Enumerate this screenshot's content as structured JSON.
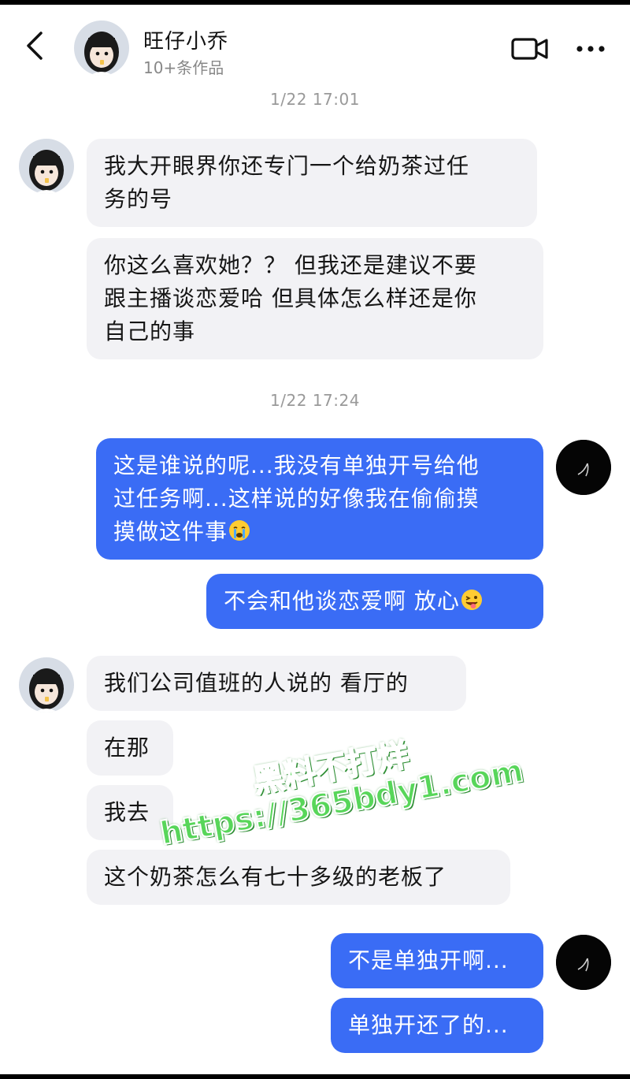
{
  "header": {
    "name": "旺仔小乔",
    "subtitle": "10+条作品"
  },
  "messages": {
    "ts1": "1/22 17:01",
    "m1": "我大开眼界你还专门一个给奶茶过任\n务的号",
    "m2": "你这么喜欢她？？ 但我还是建议不要\n跟主播谈恋爱哈 但具体怎么样还是你\n自己的事",
    "ts2": "1/22 17:24",
    "m3": "这是谁说的呢...我没有单独开号给他\n过任务啊...这样说的好像我在偷偷摸\n摸做这件事",
    "m4": "不会和他谈恋爱啊 放心",
    "m5": "我们公司值班的人说的 看厅的",
    "m6": "在那",
    "m7": "我去",
    "m8": "这个奶茶怎么有七十多级的老板了",
    "m9": "不是单独开啊...",
    "m10": "单独开还了的..."
  },
  "watermark": {
    "line1": "黑料不打烊",
    "line2": "https://365bdy1.com"
  },
  "icons": {
    "back": "chevron-left-icon",
    "video": "video-camera-icon",
    "more": "more-horizontal-icon",
    "crying": "crying-face-emoji",
    "tongue": "winking-tongue-emoji"
  },
  "colors": {
    "outgoing_bubble": "#3a6cf5",
    "incoming_bubble": "#f2f2f5",
    "timestamp": "#999999",
    "watermark": "#58d65a"
  }
}
